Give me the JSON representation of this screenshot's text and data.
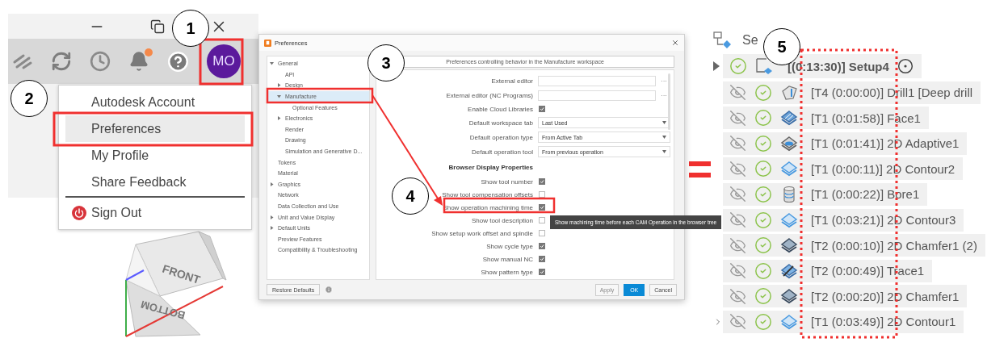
{
  "account_panel": {
    "avatar": "MO",
    "notification": true,
    "menu": [
      {
        "label": "Autodesk Account",
        "selected": false,
        "kind": "item"
      },
      {
        "label": "Preferences",
        "selected": true,
        "kind": "item"
      },
      {
        "label": "My Profile",
        "selected": false,
        "kind": "item"
      },
      {
        "label": "Share Feedback",
        "selected": false,
        "kind": "item"
      },
      {
        "label": "Sign Out",
        "selected": false,
        "kind": "sign_out"
      }
    ]
  },
  "viewcube": {
    "faces": [
      "FRONT",
      "BOTTOM"
    ]
  },
  "preferences_dialog": {
    "title": "Preferences",
    "tree": [
      {
        "label": "General",
        "expanded": true,
        "selected": false,
        "children": [
          {
            "label": "API",
            "selected": false
          },
          {
            "label": "Design",
            "expanded": false,
            "selected": false
          },
          {
            "label": "Manufacture",
            "expanded": true,
            "selected": true,
            "children": [
              {
                "label": "Optional Features",
                "selected": false
              }
            ]
          },
          {
            "label": "Electronics",
            "expanded": false,
            "selected": false
          },
          {
            "label": "Render",
            "selected": false
          },
          {
            "label": "Drawing",
            "selected": false
          },
          {
            "label": "Simulation and Generative D...",
            "selected": false
          }
        ]
      },
      {
        "label": "Tokens",
        "selected": false
      },
      {
        "label": "Material",
        "selected": false
      },
      {
        "label": "Graphics",
        "expanded": false,
        "selected": false
      },
      {
        "label": "Network",
        "selected": false
      },
      {
        "label": "Data Collection and Use",
        "selected": false
      },
      {
        "label": "Unit and Value Display",
        "expanded": false,
        "selected": false
      },
      {
        "label": "Default Units",
        "expanded": false,
        "selected": false
      },
      {
        "label": "Preview Features",
        "selected": false
      },
      {
        "label": "Compatibility & Troubleshooting",
        "selected": false
      }
    ],
    "header": "Preferences controlling behavior in the Manufacture workspace",
    "settings": [
      {
        "kind": "text",
        "label": "External editor",
        "button": "···"
      },
      {
        "kind": "text",
        "label": "External editor (NC Programs)",
        "button": "···"
      },
      {
        "kind": "checkbox",
        "label": "Enable Cloud Libraries",
        "checked": true
      },
      {
        "kind": "select",
        "label": "Default workspace tab",
        "value": "Last Used"
      },
      {
        "kind": "select",
        "label": "Default operation type",
        "value": "From Active Tab"
      },
      {
        "kind": "select",
        "label": "Default operation tool",
        "value": "From previous operation"
      },
      {
        "kind": "heading",
        "label": "Browser Display Properties"
      },
      {
        "kind": "checkbox",
        "label": "Show tool number",
        "checked": true
      },
      {
        "kind": "checkbox",
        "label": "Show tool compensation offsets",
        "checked": false
      },
      {
        "kind": "checkbox",
        "label": "Show operation machining time",
        "checked": true
      },
      {
        "kind": "checkbox",
        "label": "Show tool description",
        "checked": false
      },
      {
        "kind": "checkbox",
        "label": "Show setup work offset and spindle",
        "checked": false
      },
      {
        "kind": "checkbox",
        "label": "Show cycle type",
        "checked": true
      },
      {
        "kind": "checkbox",
        "label": "Show manual NC",
        "checked": true
      },
      {
        "kind": "checkbox",
        "label": "Show pattern type",
        "checked": true
      }
    ],
    "tooltip": "Show machining time before each CAM Operation in the browser tree",
    "restore_button": "Restore Defaults",
    "buttons": [
      {
        "label": "Apply",
        "kind": "default",
        "disabled": true
      },
      {
        "label": "OK",
        "kind": "primary",
        "disabled": false
      },
      {
        "label": "Cancel",
        "kind": "default",
        "disabled": false
      }
    ]
  },
  "browser_tree": {
    "header": "Se",
    "setup": {
      "label": "[(0:13:30)] Setup4",
      "expanded": false
    },
    "operations": [
      {
        "label": "[T4 (0:00:00)] Drill1 [Deep drill",
        "kind": "drill",
        "expandable": false
      },
      {
        "label": "[T1 (0:01:58)] Face1",
        "kind": "face",
        "expandable": false
      },
      {
        "label": "[T1 (0:01:41)] 2D Adaptive1",
        "kind": "adaptive",
        "expandable": false
      },
      {
        "label": "[T1 (0:00:11)] 2D Contour2",
        "kind": "contour",
        "expandable": false
      },
      {
        "label": "[T1 (0:00:22)] Bore1",
        "kind": "bore",
        "expandable": false
      },
      {
        "label": "[T1 (0:03:21)] 2D Contour3",
        "kind": "contour",
        "expandable": false
      },
      {
        "label": "[T2 (0:00:10)] 2D Chamfer1 (2)",
        "kind": "chamfer",
        "expandable": false
      },
      {
        "label": "[T2 (0:00:49)] Trace1",
        "kind": "trace",
        "expandable": false
      },
      {
        "label": "[T2 (0:00:20)] 2D Chamfer1",
        "kind": "chamfer",
        "expandable": false
      },
      {
        "label": "[T1 (0:03:49)] 2D Contour1",
        "kind": "contour",
        "expandable": true
      }
    ]
  },
  "callouts": [
    "1",
    "2",
    "3",
    "4",
    "5"
  ]
}
